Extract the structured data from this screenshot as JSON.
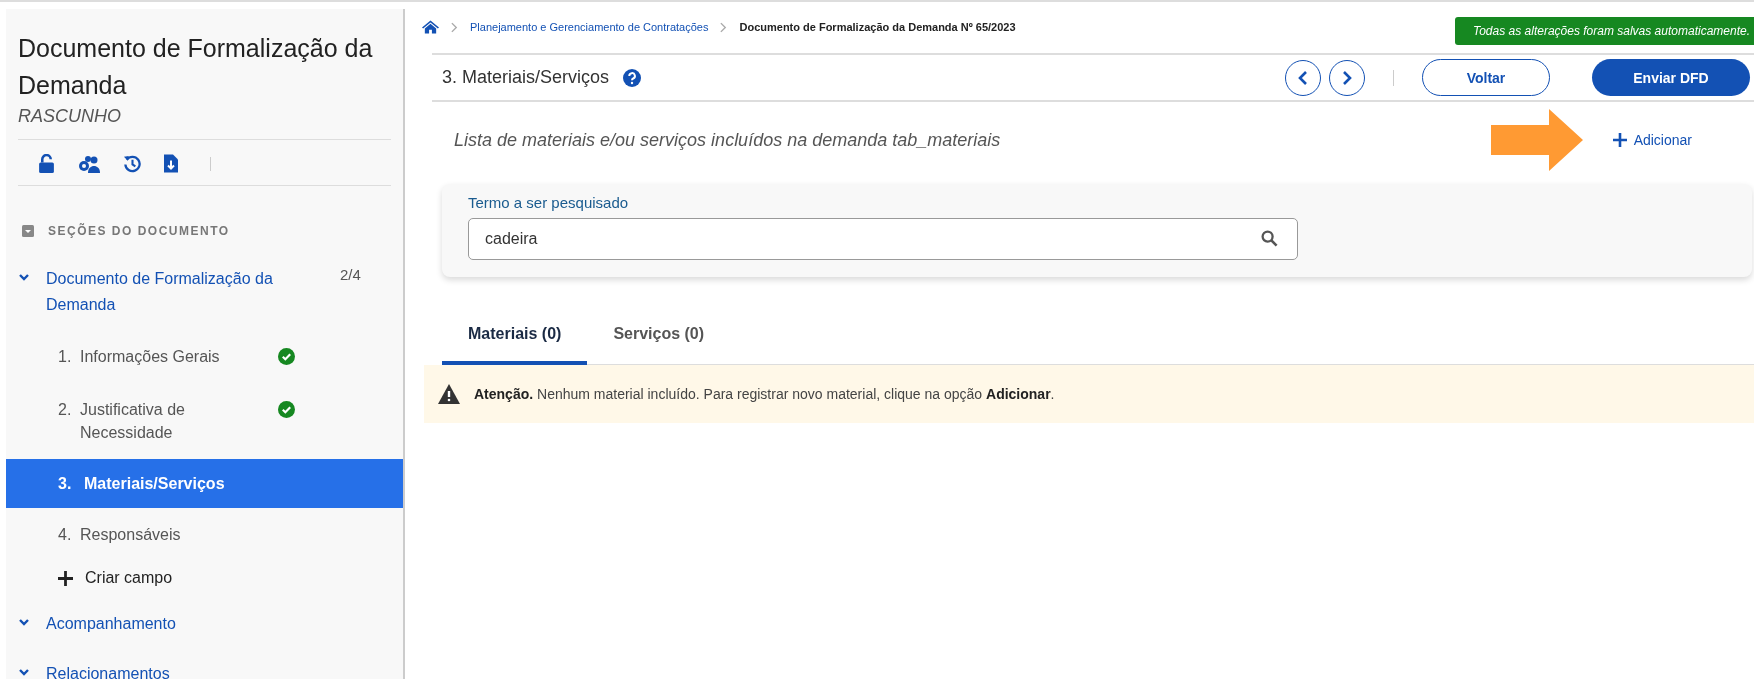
{
  "sidebar": {
    "title": "Documento de Formalização da Demanda",
    "status": "RASCUNHO",
    "section_header": "SEÇÕES DO DOCUMENTO",
    "tree": [
      {
        "label": "Documento de Formalização da Demanda",
        "count": "2/4",
        "children": [
          {
            "number": "1.",
            "label": "Informações Gerais",
            "done": true,
            "selected": false
          },
          {
            "number": "2.",
            "label": "Justificativa de Necessidade",
            "done": true,
            "selected": false
          },
          {
            "number": "3.",
            "label": "Materiais/Serviços",
            "done": false,
            "selected": true
          },
          {
            "number": "4.",
            "label": "Responsáveis",
            "done": false,
            "selected": false
          }
        ],
        "action": "Criar campo"
      },
      {
        "label": "Acompanhamento"
      },
      {
        "label": "Relacionamentos"
      }
    ]
  },
  "breadcrumb": [
    "Planejamento e Gerenciamento de Contratações",
    "Documento de Formalização da Demanda Nº 65/2023"
  ],
  "autosave_message": "Todas as alterações foram salvas automaticamente.",
  "page_title": "3. Materiais/Serviços",
  "buttons": [
    {
      "label": "Voltar",
      "kind": "outline"
    },
    {
      "label": "Enviar DFD",
      "kind": "primary"
    }
  ],
  "description": "Lista de materiais e/ou serviços incluídos na demanda tab_materiais",
  "add_link": "Adicionar",
  "search": {
    "label": "Termo a ser pesquisado",
    "value": "cadeira"
  },
  "tabs": [
    {
      "label": "Materiais (0)",
      "selected": true
    },
    {
      "label": "Serviços (0)",
      "selected": false
    }
  ],
  "alert": "**Atenção.** Nenhum material incluído. Para registrar novo material, clique na opção **Adicionar**."
}
